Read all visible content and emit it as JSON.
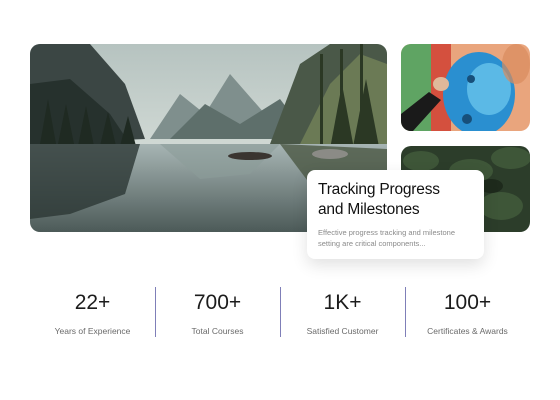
{
  "feature_card": {
    "title_line1": "Tracking Progress",
    "title_line2": "and Milestones",
    "description_line1": "Effective progress tracking and milestone",
    "description_line2": "setting are critical components..."
  },
  "stats": [
    {
      "value": "22+",
      "label": "Years of Experience"
    },
    {
      "value": "700+",
      "label": "Total Courses"
    },
    {
      "value": "1K+",
      "label": "Satisfied Customer"
    },
    {
      "value": "100+",
      "label": "Certificates & Awards"
    }
  ],
  "colors": {
    "divider": "#7f7fb8",
    "lake_sky": "#c9d3d0",
    "mural_orange": "#e9a57d",
    "mural_blue": "#2a8fd0",
    "foliage": "#2c3d2a"
  }
}
